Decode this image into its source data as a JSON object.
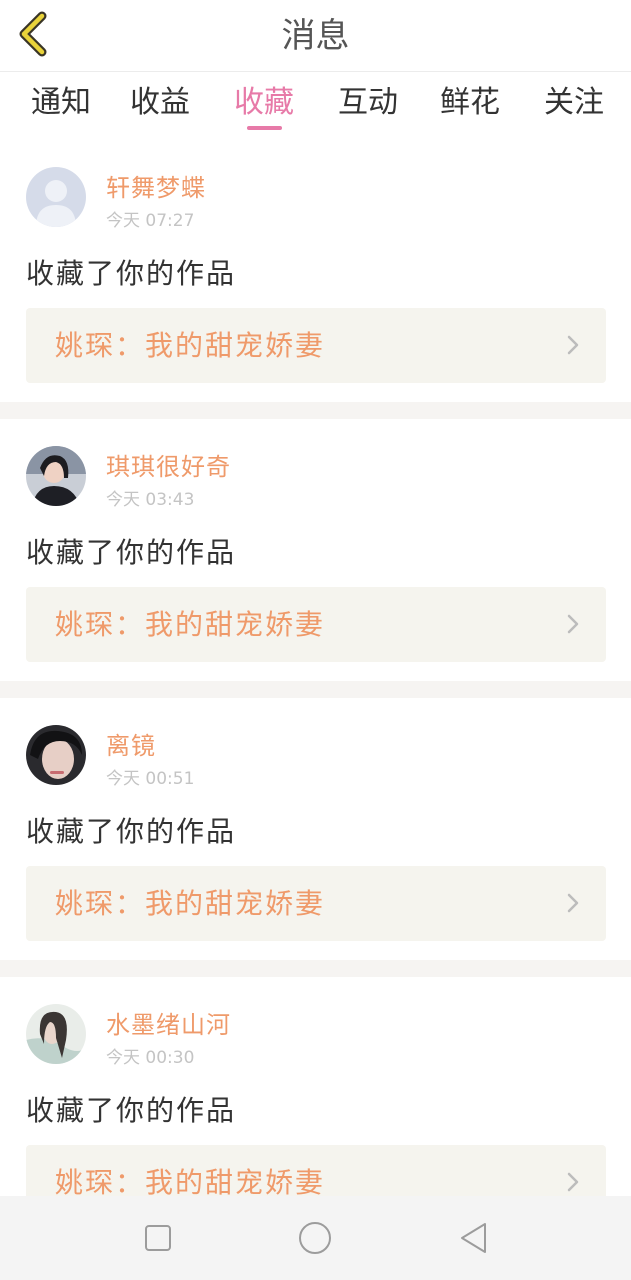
{
  "header": {
    "title": "消息",
    "back_icon": "chevron-left-icon",
    "accent_color": "#e9d33a"
  },
  "tabs": [
    {
      "label": "通知"
    },
    {
      "label": "收益"
    },
    {
      "label": "收藏",
      "active": true
    },
    {
      "label": "互动"
    },
    {
      "label": "鲜花"
    },
    {
      "label": "关注"
    }
  ],
  "active_tab_color": "#e77aa8",
  "messages": [
    {
      "username": "轩舞梦蝶",
      "time": "今天 07:27",
      "action": "收藏了你的作品",
      "work_title": "姚琛：我的甜宠娇妻",
      "avatar": "default-avatar-icon"
    },
    {
      "username": "琪琪很好奇",
      "time": "今天 03:43",
      "action": "收藏了你的作品",
      "work_title": "姚琛：我的甜宠娇妻",
      "avatar": "user-photo"
    },
    {
      "username": "离镜",
      "time": "今天 00:51",
      "action": "收藏了你的作品",
      "work_title": "姚琛：我的甜宠娇妻",
      "avatar": "user-photo"
    },
    {
      "username": "水墨绪山河",
      "time": "今天 00:30",
      "action": "收藏了你的作品",
      "work_title": "姚琛：我的甜宠娇妻",
      "avatar": "user-photo"
    }
  ],
  "navbar": {
    "icons": [
      "square-icon",
      "circle-icon",
      "triangle-back-icon"
    ]
  }
}
